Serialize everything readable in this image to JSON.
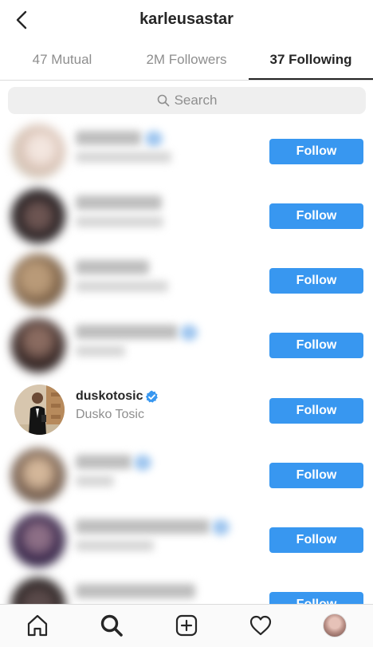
{
  "header": {
    "title": "karleusastar"
  },
  "tabs": [
    {
      "label": "47 Mutual",
      "active": false
    },
    {
      "label": "2M Followers",
      "active": false
    },
    {
      "label": "37 Following",
      "active": true
    }
  ],
  "search": {
    "placeholder": "Search"
  },
  "list": {
    "follow_label": "Follow",
    "featured": {
      "username": "duskotosic",
      "full_name": "Dusko Tosic",
      "verified": true
    }
  },
  "colors": {
    "accent": "#3897f0",
    "text": "#262626",
    "muted": "#8e8e8e",
    "separator": "#dbdbdb"
  },
  "bottom_nav": [
    {
      "icon": "home-icon"
    },
    {
      "icon": "search-icon",
      "active": true
    },
    {
      "icon": "new-post-icon"
    },
    {
      "icon": "activity-heart-icon"
    },
    {
      "icon": "profile-avatar"
    }
  ]
}
